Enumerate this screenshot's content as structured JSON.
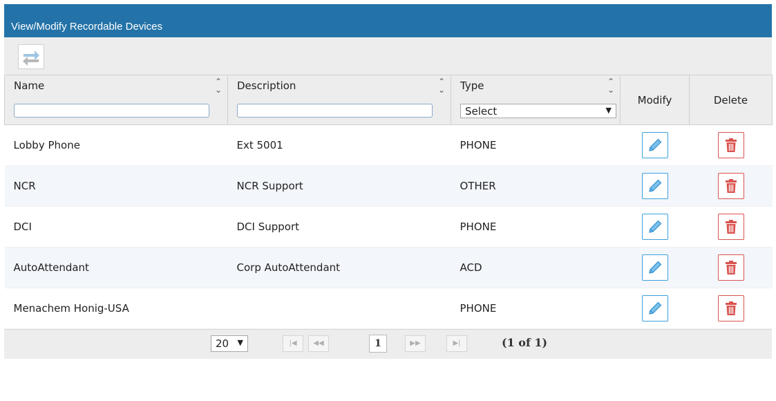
{
  "window": {
    "title": "View/Modify Recordable Devices"
  },
  "toolbar": {
    "icon": "swap-arrows-icon"
  },
  "columns": {
    "name": "Name",
    "description": "Description",
    "type": "Type",
    "type_select_value": "Select",
    "modify": "Modify",
    "delete": "Delete"
  },
  "rows": [
    {
      "name": "Lobby Phone",
      "description": "Ext 5001",
      "type": "PHONE"
    },
    {
      "name": "NCR",
      "description": "NCR Support",
      "type": "OTHER"
    },
    {
      "name": "DCI",
      "description": "DCI Support",
      "type": "PHONE"
    },
    {
      "name": "AutoAttendant",
      "description": "Corp AutoAttendant",
      "type": "ACD"
    },
    {
      "name": "Menachem Honig-USA",
      "description": "",
      "type": "PHONE"
    }
  ],
  "pager": {
    "rows_per_page": "20",
    "current_page": "1",
    "page_info": "(1 of 1)"
  },
  "colors": {
    "title_bar": "#2473a8",
    "edit": "#3aa0dc",
    "delete": "#d9534f"
  }
}
